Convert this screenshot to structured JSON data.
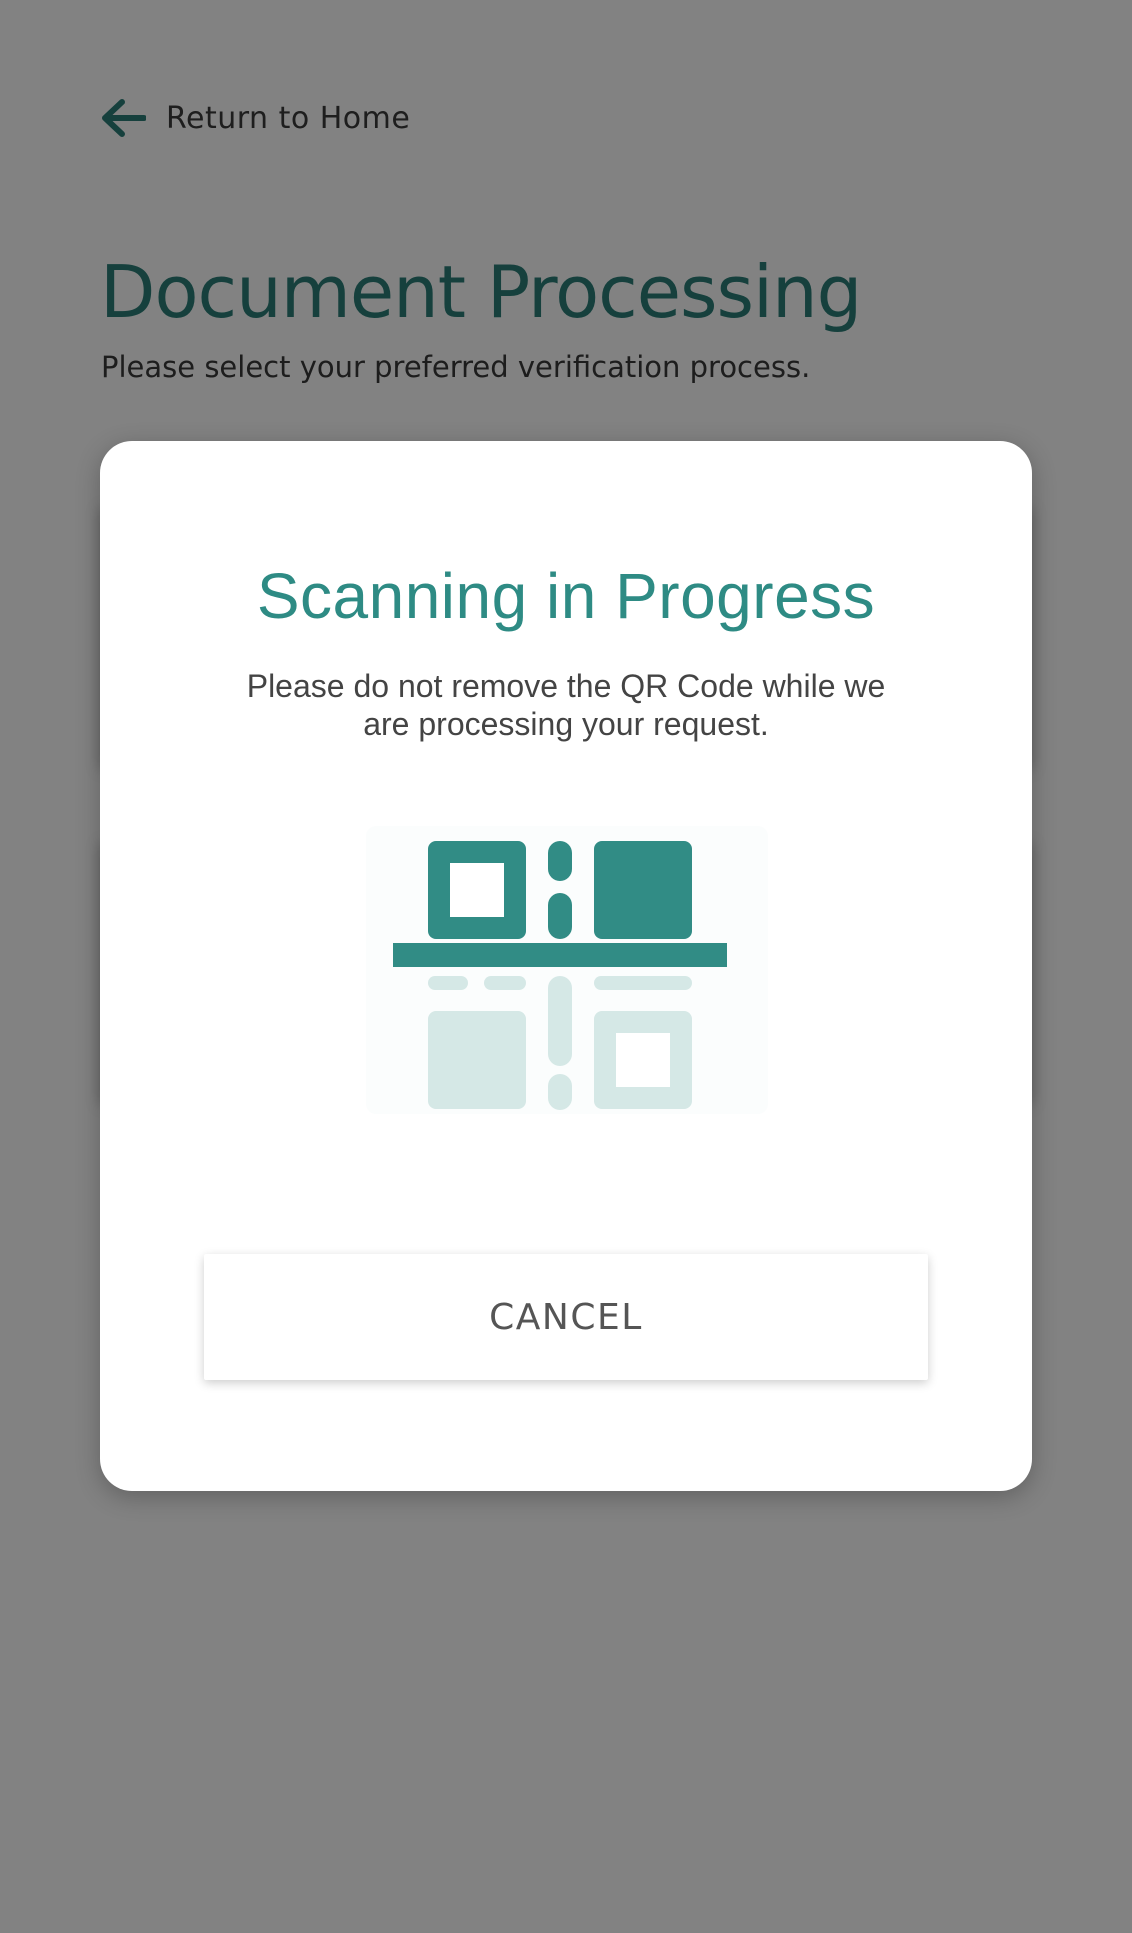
{
  "page": {
    "back_link": {
      "label": "Return to Home",
      "icon": "arrow-left-icon"
    },
    "title": "Document Processing",
    "subtitle": "Please select your preferred verification process."
  },
  "modal": {
    "title": "Scanning in Progress",
    "message": "Please do not remove the QR Code while we are processing your request.",
    "illustration_icon": "qr-code-scan-icon",
    "cancel_label": "CANCEL"
  },
  "colors": {
    "accent": "#2e8b84",
    "accent_light": "#d5e8e6",
    "overlay": "rgba(0,0,0,0.49)",
    "text_dark": "#3a3a3a"
  }
}
